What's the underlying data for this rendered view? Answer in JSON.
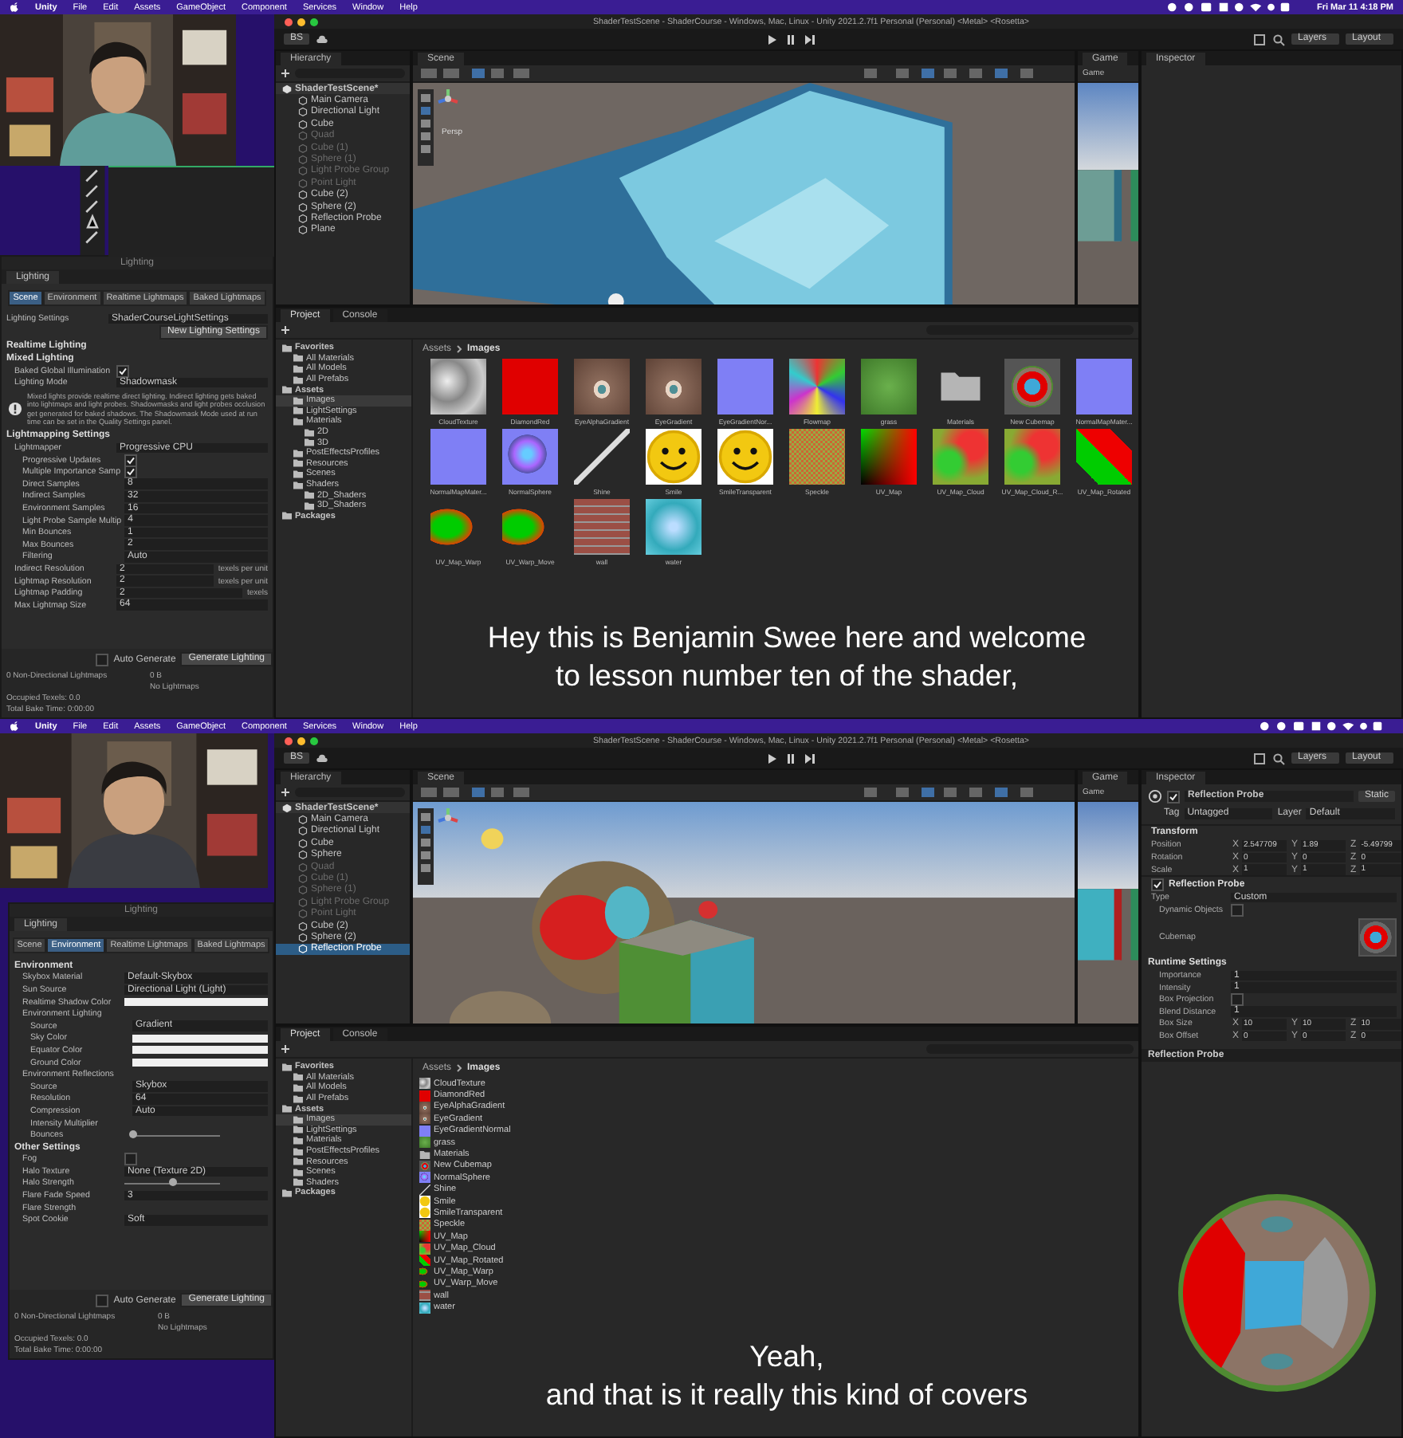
{
  "frames": [
    {
      "menu_bar": {
        "items": [
          "Unity",
          "File",
          "Edit",
          "Assets",
          "GameObject",
          "Component",
          "Services",
          "Window",
          "Help"
        ],
        "clock": "Fri Mar 11  4:18 PM"
      },
      "webcam": {
        "kind": "picture"
      },
      "window_title": "ShaderTestScene - ShaderCourse - Windows, Mac, Linux - Unity 2021.2.7f1 Personal (Personal) <Metal> <Rosetta>",
      "toolbar": {
        "account": "BS",
        "layers": "Layers",
        "layout": "Layout"
      },
      "hierarchy": {
        "tab": "Hierarchy",
        "scene": "ShaderTestScene*",
        "items": [
          {
            "label": "Main Camera",
            "disabled": false,
            "selected": false
          },
          {
            "label": "Directional Light",
            "disabled": false,
            "selected": false
          },
          {
            "label": "Cube",
            "disabled": false,
            "selected": false
          },
          {
            "label": "Quad",
            "disabled": true,
            "selected": false
          },
          {
            "label": "Cube (1)",
            "disabled": true,
            "selected": false
          },
          {
            "label": "Sphere (1)",
            "disabled": true,
            "selected": false
          },
          {
            "label": "Light Probe Group",
            "disabled": true,
            "selected": false
          },
          {
            "label": "Point Light",
            "disabled": true,
            "selected": false
          },
          {
            "label": "Cube (2)",
            "disabled": false,
            "selected": false
          },
          {
            "label": "Sphere (2)",
            "disabled": false,
            "selected": false
          },
          {
            "label": "Reflection Probe",
            "disabled": false,
            "selected": false
          },
          {
            "label": "Plane",
            "disabled": false,
            "selected": false
          }
        ]
      },
      "scene_view": {
        "tab": "Scene",
        "persp": "Persp"
      },
      "game_view": {
        "tab": "Game",
        "display": "Game"
      },
      "inspector": {
        "tab": "Inspector"
      },
      "lighting": {
        "title": "Lighting",
        "tab": "Lighting",
        "tabs": [
          {
            "label": "Scene",
            "selected": true
          },
          {
            "label": "Environment",
            "selected": false
          },
          {
            "label": "Realtime Lightmaps",
            "selected": false
          },
          {
            "label": "Baked Lightmaps",
            "selected": false
          }
        ],
        "rows": [
          {
            "kind": "field",
            "label": "Lighting Settings",
            "value": "ShaderCourseLightSettings"
          },
          {
            "kind": "button",
            "label": "New Lighting Settings"
          },
          {
            "kind": "section",
            "label": "Realtime Lighting"
          },
          {
            "kind": "section",
            "label": "Mixed Lighting",
            "children": [
              {
                "kind": "check",
                "label": "Baked Global Illumination",
                "checked": true
              },
              {
                "kind": "field",
                "label": "Lighting Mode",
                "value": "Shadowmask"
              },
              {
                "kind": "info",
                "label": "Mixed lights provide realtime direct lighting. Indirect lighting gets baked into lightmaps and light probes. Shadowmasks and light probes occlusion get generated for baked shadows. The Shadowmask Mode used at run time can be set in the Quality Settings panel."
              }
            ]
          },
          {
            "kind": "section",
            "label": "Lightmapping Settings",
            "children": [
              {
                "kind": "field",
                "label": "Lightmapper",
                "value": "Progressive CPU",
                "children": [
                  {
                    "kind": "check",
                    "label": "Progressive Updates",
                    "checked": true
                  },
                  {
                    "kind": "check",
                    "label": "Multiple Importance Samp",
                    "checked": true
                  },
                  {
                    "kind": "field",
                    "label": "Direct Samples",
                    "value": "8"
                  },
                  {
                    "kind": "field",
                    "label": "Indirect Samples",
                    "value": "32"
                  },
                  {
                    "kind": "field",
                    "label": "Environment Samples",
                    "value": "16"
                  },
                  {
                    "kind": "field",
                    "label": "Light Probe Sample Multip",
                    "value": "4"
                  },
                  {
                    "kind": "field",
                    "label": "Min Bounces",
                    "value": "1"
                  },
                  {
                    "kind": "field",
                    "label": "Max Bounces",
                    "value": "2"
                  },
                  {
                    "kind": "field",
                    "label": "Filtering",
                    "value": "Auto"
                  }
                ]
              },
              {
                "kind": "field",
                "label": "Indirect Resolution",
                "value": "2",
                "unit": "texels per unit"
              },
              {
                "kind": "field",
                "label": "Lightmap Resolution",
                "value": "2",
                "unit": "texels per unit"
              },
              {
                "kind": "field",
                "label": "Lightmap Padding",
                "value": "2",
                "unit": "texels"
              },
              {
                "kind": "field",
                "label": "Max Lightmap Size",
                "value": "64"
              }
            ]
          }
        ],
        "auto_generate": {
          "label": "Auto Generate",
          "checked": false
        },
        "generate": "Generate Lighting",
        "stats": [
          "0 Non-Directional Lightmaps",
          "0 B",
          "No Lightmaps",
          "Occupied Texels: 0.0",
          "Total Bake Time: 0:00:00"
        ]
      },
      "project": {
        "tabs": [
          {
            "label": "Project",
            "selected": true
          },
          {
            "label": "Console",
            "selected": false
          }
        ],
        "tree": [
          {
            "label": "Favorites",
            "selected": false,
            "children": [
              {
                "label": "All Materials",
                "selected": false
              },
              {
                "label": "All Models",
                "selected": false
              },
              {
                "label": "All Prefabs",
                "selected": false
              }
            ]
          },
          {
            "label": "Assets",
            "selected": false,
            "children": [
              {
                "label": "Images",
                "selected": true
              },
              {
                "label": "LightSettings",
                "selected": false
              },
              {
                "label": "Materials",
                "selected": false,
                "children": [
                  {
                    "label": "2D",
                    "selected": false
                  },
                  {
                    "label": "3D",
                    "selected": false
                  }
                ]
              },
              {
                "label": "PostEffectsProfiles",
                "selected": false
              },
              {
                "label": "Resources",
                "selected": false
              },
              {
                "label": "Scenes",
                "selected": false
              },
              {
                "label": "Shaders",
                "selected": false,
                "children": [
                  {
                    "label": "2D_Shaders",
                    "selected": false
                  },
                  {
                    "label": "3D_Shaders",
                    "selected": false
                  }
                ]
              }
            ]
          },
          {
            "label": "Packages",
            "selected": false
          }
        ],
        "breadcrumb": [
          "Assets",
          "Images"
        ],
        "assets": [
          {
            "label": "CloudTexture",
            "kind": "cloud"
          },
          {
            "label": "DiamondRed",
            "kind": "red"
          },
          {
            "label": "EyeAlphaGradient",
            "kind": "eye"
          },
          {
            "label": "EyeGradient",
            "kind": "eye"
          },
          {
            "label": "EyeGradientNor...",
            "kind": "normal"
          },
          {
            "label": "Flowmap",
            "kind": "noise"
          },
          {
            "label": "grass",
            "kind": "grass"
          },
          {
            "label": "Materials",
            "kind": "folder"
          },
          {
            "label": "New Cubemap",
            "kind": "cubemap"
          },
          {
            "label": "NormalMapMater...",
            "kind": "normal"
          },
          {
            "label": "NormalMapMater...",
            "kind": "normal"
          },
          {
            "label": "NormalSphere",
            "kind": "sphere"
          },
          {
            "label": "Shine",
            "kind": "line"
          },
          {
            "label": "Smile",
            "kind": "smile"
          },
          {
            "label": "SmileTransparent",
            "kind": "smile"
          },
          {
            "label": "Speckle",
            "kind": "speckle"
          },
          {
            "label": "UV_Map",
            "kind": "uv"
          },
          {
            "label": "UV_Map_Cloud",
            "kind": "uvcloud"
          },
          {
            "label": "UV_Map_Cloud_R...",
            "kind": "uvcloud"
          },
          {
            "label": "UV_Map_Rotated",
            "kind": "rotated"
          },
          {
            "label": "UV_Map_Warp",
            "kind": "warp"
          },
          {
            "label": "UV_Warp_Move",
            "kind": "warp"
          },
          {
            "label": "wall",
            "kind": "wall"
          },
          {
            "label": "water",
            "kind": "water"
          }
        ]
      },
      "subtitle": [
        "Hey this is Benjamin Swee here and welcome",
        "to lesson number ten of the shader,"
      ]
    },
    {
      "menu_bar": {
        "items": [
          "Unity",
          "File",
          "Edit",
          "Assets",
          "GameObject",
          "Component",
          "Services",
          "Window",
          "Help"
        ]
      },
      "webcam": {
        "kind": "picture"
      },
      "window_title": "ShaderTestScene - ShaderCourse - Windows, Mac, Linux - Unity 2021.2.7f1 Personal (Personal) <Metal> <Rosetta>",
      "toolbar": {
        "account": "BS",
        "layers": "Layers",
        "layout": "Layout"
      },
      "hierarchy": {
        "tab": "Hierarchy",
        "scene": "ShaderTestScene*",
        "items": [
          {
            "label": "Main Camera",
            "disabled": false,
            "selected": false
          },
          {
            "label": "Directional Light",
            "disabled": false,
            "selected": false
          },
          {
            "label": "Cube",
            "disabled": false,
            "selected": false
          },
          {
            "label": "Sphere",
            "disabled": false,
            "selected": false
          },
          {
            "label": "Quad",
            "disabled": true,
            "selected": false
          },
          {
            "label": "Cube (1)",
            "disabled": true,
            "selected": false
          },
          {
            "label": "Sphere (1)",
            "disabled": true,
            "selected": false
          },
          {
            "label": "Light Probe Group",
            "disabled": true,
            "selected": false
          },
          {
            "label": "Point Light",
            "disabled": true,
            "selected": false
          },
          {
            "label": "Cube (2)",
            "disabled": false,
            "selected": false
          },
          {
            "label": "Sphere (2)",
            "disabled": false,
            "selected": false
          },
          {
            "label": "Reflection Probe",
            "disabled": false,
            "selected": true
          }
        ]
      },
      "scene_view": {
        "tab": "Scene"
      },
      "game_view": {
        "tab": "Game",
        "display": "Game"
      },
      "inspector": {
        "tab": "Inspector",
        "object": {
          "name": "Reflection Probe",
          "active": true,
          "static": "Static",
          "tag_label": "Tag",
          "tag": "Untagged",
          "layer_label": "Layer",
          "layer": "Default"
        },
        "components": [
          {
            "title": "Transform",
            "rows": [
              {
                "kind": "vector",
                "label": "Position",
                "values": [
                  {
                    "axis": "X",
                    "value": "2.547709"
                  },
                  {
                    "axis": "Y",
                    "value": "1.89"
                  },
                  {
                    "axis": "Z",
                    "value": "-5.49799"
                  }
                ]
              },
              {
                "kind": "vector",
                "label": "Rotation",
                "values": [
                  {
                    "axis": "X",
                    "value": "0"
                  },
                  {
                    "axis": "Y",
                    "value": "0"
                  },
                  {
                    "axis": "Z",
                    "value": "0"
                  }
                ]
              },
              {
                "kind": "vector",
                "label": "Scale",
                "values": [
                  {
                    "axis": "X",
                    "value": "1"
                  },
                  {
                    "axis": "Y",
                    "value": "1"
                  },
                  {
                    "axis": "Z",
                    "value": "1"
                  }
                ]
              }
            ]
          },
          {
            "title": "Reflection Probe",
            "enabled": true,
            "rows": [
              {
                "kind": "field",
                "label": "Type",
                "value": "Custom",
                "children": [
                  {
                    "kind": "check",
                    "label": "Dynamic Objects",
                    "checked": false
                  },
                  {
                    "kind": "texture",
                    "label": "Cubemap"
                  }
                ]
              },
              {
                "kind": "section",
                "label": "Runtime Settings",
                "children": [
                  {
                    "kind": "field",
                    "label": "Importance",
                    "value": "1"
                  },
                  {
                    "kind": "field",
                    "label": "Intensity",
                    "value": "1"
                  },
                  {
                    "kind": "check",
                    "label": "Box Projection",
                    "checked": false
                  },
                  {
                    "kind": "field",
                    "label": "Blend Distance",
                    "value": "1"
                  },
                  {
                    "kind": "vector",
                    "label": "Box Size",
                    "values": [
                      {
                        "axis": "X",
                        "value": "10"
                      },
                      {
                        "axis": "Y",
                        "value": "10"
                      },
                      {
                        "axis": "Z",
                        "value": "10"
                      }
                    ]
                  },
                  {
                    "kind": "vector",
                    "label": "Box Offset",
                    "values": [
                      {
                        "axis": "X",
                        "value": "0"
                      },
                      {
                        "axis": "Y",
                        "value": "0"
                      },
                      {
                        "axis": "Z",
                        "value": "0"
                      }
                    ]
                  }
                ]
              }
            ]
          }
        ],
        "preview_title": "Reflection Probe",
        "preview": {
          "kind": "picture"
        }
      },
      "lighting": {
        "title": "Lighting",
        "tab": "Lighting",
        "tabs": [
          {
            "label": "Scene",
            "selected": false
          },
          {
            "label": "Environment",
            "selected": true
          },
          {
            "label": "Realtime Lightmaps",
            "selected": false
          },
          {
            "label": "Baked Lightmaps",
            "selected": false
          }
        ],
        "rows": [
          {
            "kind": "section",
            "label": "Environment",
            "children": [
              {
                "kind": "field",
                "label": "Skybox Material",
                "value": "Default-Skybox"
              },
              {
                "kind": "field",
                "label": "Sun Source",
                "value": "Directional Light (Light)"
              },
              {
                "kind": "swatch",
                "label": "Realtime Shadow Color"
              },
              {
                "kind": "label",
                "label": "Environment Lighting",
                "children": [
                  {
                    "kind": "field",
                    "label": "Source",
                    "value": "Gradient"
                  },
                  {
                    "kind": "swatch",
                    "label": "Sky Color"
                  },
                  {
                    "kind": "swatch",
                    "label": "Equator Color"
                  },
                  {
                    "kind": "swatch",
                    "label": "Ground Color"
                  }
                ]
              },
              {
                "kind": "label",
                "label": "Environment Reflections",
                "children": [
                  {
                    "kind": "field",
                    "label": "Source",
                    "value": "Skybox"
                  },
                  {
                    "kind": "field",
                    "label": "Resolution",
                    "value": "64"
                  },
                  {
                    "kind": "field",
                    "label": "Compression",
                    "value": "Auto"
                  },
                  {
                    "kind": "label",
                    "label": "Intensity Multiplier"
                  },
                  {
                    "kind": "slider",
                    "label": "Bounces",
                    "level": 0
                  }
                ]
              }
            ]
          },
          {
            "kind": "section",
            "label": "Other Settings",
            "children": [
              {
                "kind": "check",
                "label": "Fog",
                "checked": false
              },
              {
                "kind": "field",
                "label": "Halo Texture",
                "value": "None (Texture 2D)"
              },
              {
                "kind": "slider",
                "label": "Halo Strength",
                "level": 0.5
              },
              {
                "kind": "field",
                "label": "Flare Fade Speed",
                "value": "3"
              },
              {
                "kind": "label",
                "label": "Flare Strength"
              },
              {
                "kind": "field",
                "label": "Spot Cookie",
                "value": "Soft"
              }
            ]
          }
        ],
        "auto_generate": {
          "label": "Auto Generate",
          "checked": false
        },
        "generate": "Generate Lighting",
        "stats": [
          "0 Non-Directional Lightmaps",
          "0 B",
          "No Lightmaps",
          "Occupied Texels: 0.0",
          "Total Bake Time: 0:00:00"
        ]
      },
      "project": {
        "tabs": [
          {
            "label": "Project",
            "selected": true
          },
          {
            "label": "Console",
            "selected": false
          }
        ],
        "tree": [
          {
            "label": "Favorites",
            "selected": false,
            "children": [
              {
                "label": "All Materials",
                "selected": false
              },
              {
                "label": "All Models",
                "selected": false
              },
              {
                "label": "All Prefabs",
                "selected": false
              }
            ]
          },
          {
            "label": "Assets",
            "selected": false,
            "children": [
              {
                "label": "Images",
                "selected": true
              },
              {
                "label": "LightSettings",
                "selected": false
              },
              {
                "label": "Materials",
                "selected": false
              },
              {
                "label": "PostEffectsProfiles",
                "selected": false
              },
              {
                "label": "Resources",
                "selected": false
              },
              {
                "label": "Scenes",
                "selected": false
              },
              {
                "label": "Shaders",
                "selected": false
              }
            ]
          },
          {
            "label": "Packages",
            "selected": false
          }
        ],
        "breadcrumb": [
          "Assets",
          "Images"
        ],
        "assets": [
          {
            "label": "CloudTexture",
            "kind": "cloud"
          },
          {
            "label": "DiamondRed",
            "kind": "red"
          },
          {
            "label": "EyeAlphaGradient",
            "kind": "eye"
          },
          {
            "label": "EyeGradient",
            "kind": "eye"
          },
          {
            "label": "EyeGradientNormal",
            "kind": "normal"
          },
          {
            "label": "grass",
            "kind": "grass"
          },
          {
            "label": "Materials",
            "kind": "folder"
          },
          {
            "label": "New Cubemap",
            "kind": "cubemap"
          },
          {
            "label": "NormalSphere",
            "kind": "sphere"
          },
          {
            "label": "Shine",
            "kind": "line"
          },
          {
            "label": "Smile",
            "kind": "smile"
          },
          {
            "label": "SmileTransparent",
            "kind": "smile"
          },
          {
            "label": "Speckle",
            "kind": "speckle"
          },
          {
            "label": "UV_Map",
            "kind": "uv"
          },
          {
            "label": "UV_Map_Cloud",
            "kind": "uvcloud"
          },
          {
            "label": "UV_Map_Rotated",
            "kind": "rotated"
          },
          {
            "label": "UV_Map_Warp",
            "kind": "warp"
          },
          {
            "label": "UV_Warp_Move",
            "kind": "warp"
          },
          {
            "label": "wall",
            "kind": "wall"
          },
          {
            "label": "water",
            "kind": "water"
          }
        ]
      },
      "subtitle": [
        "Yeah,",
        "and that is it really this kind of covers"
      ]
    }
  ]
}
